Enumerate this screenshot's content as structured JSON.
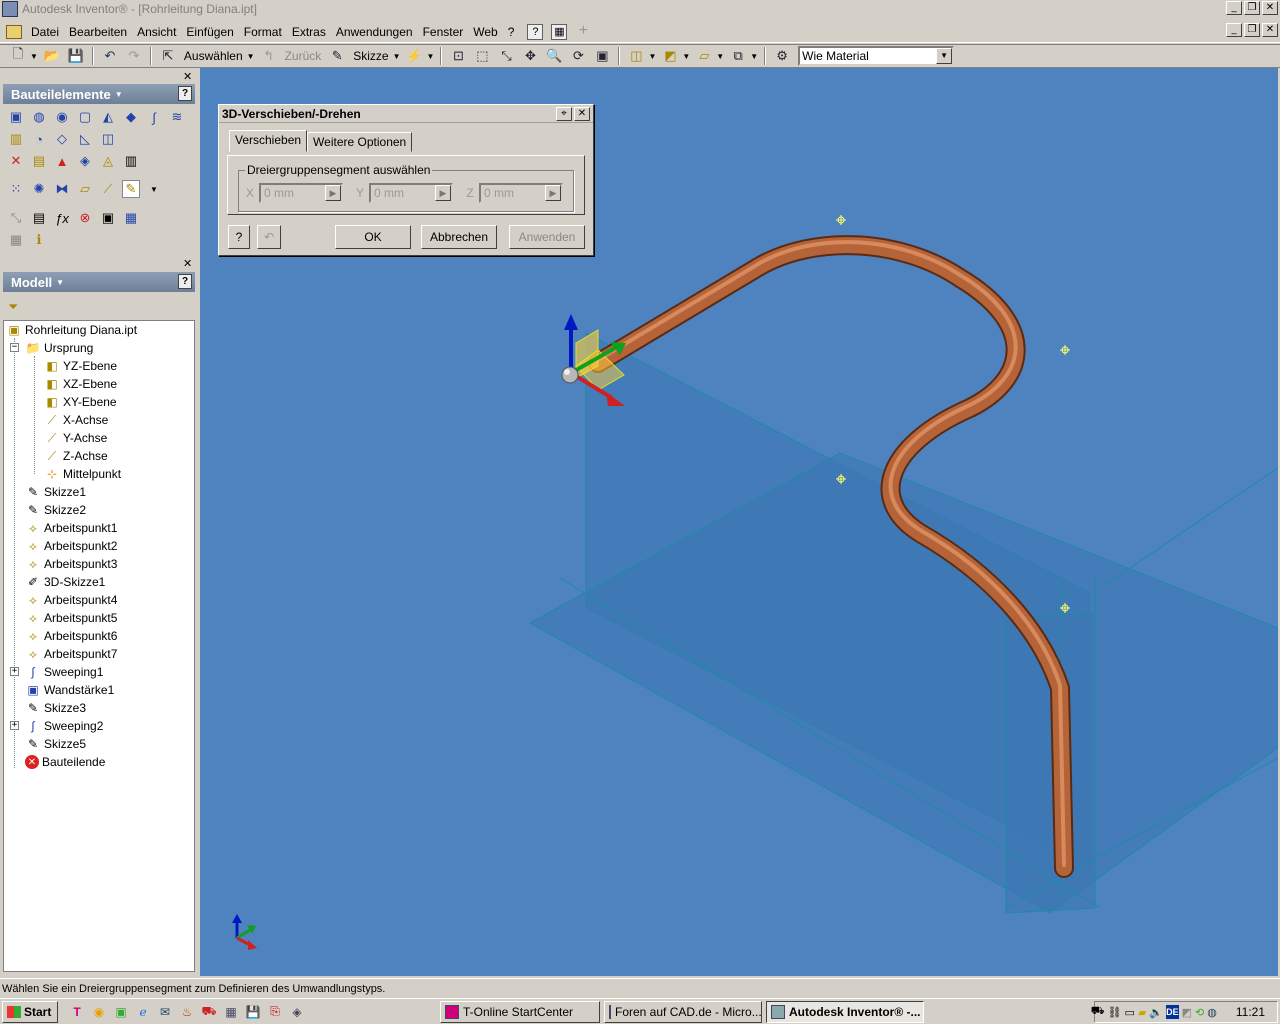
{
  "window": {
    "title": "Autodesk Inventor® - [Rohrleitung Diana.ipt]"
  },
  "menu": [
    "Datei",
    "Bearbeiten",
    "Ansicht",
    "Einfügen",
    "Format",
    "Extras",
    "Anwendungen",
    "Fenster",
    "Web",
    "?"
  ],
  "toolbar": {
    "select_label": "Auswählen",
    "back_label": "Zurück",
    "sketch_label": "Skizze",
    "material_value": "Wie Material"
  },
  "features_panel": {
    "title": "Bauteilelemente"
  },
  "model_panel": {
    "title": "Modell"
  },
  "tree": {
    "root": "Rohrleitung Diana.ipt",
    "origin": "Ursprung",
    "origin_children": [
      "YZ-Ebene",
      "XZ-Ebene",
      "XY-Ebene",
      "X-Achse",
      "Y-Achse",
      "Z-Achse",
      "Mittelpunkt"
    ],
    "items": [
      "Skizze1",
      "Skizze2",
      "Arbeitspunkt1",
      "Arbeitspunkt2",
      "Arbeitspunkt3",
      "3D-Skizze1",
      "Arbeitspunkt4",
      "Arbeitspunkt5",
      "Arbeitspunkt6",
      "Arbeitspunkt7",
      "Sweeping1",
      "Wandstärke1",
      "Skizze3",
      "Sweeping2",
      "Skizze5",
      "Bauteilende"
    ]
  },
  "dialog": {
    "title": "3D-Verschieben/-Drehen",
    "tabs": [
      "Verschieben",
      "Weitere Optionen"
    ],
    "group_label": "Dreiergruppensegment auswählen",
    "x_label": "X",
    "y_label": "Y",
    "z_label": "Z",
    "x_value": "0 mm",
    "y_value": "0 mm",
    "z_value": "0 mm",
    "ok": "OK",
    "cancel": "Abbrechen",
    "apply": "Anwenden"
  },
  "status": {
    "text": "Wählen Sie ein Dreiergruppensegment zum Definieren des Umwandlungstyps."
  },
  "taskbar": {
    "start": "Start",
    "tasks": [
      "T-Online StartCenter",
      "Foren auf CAD.de - Micro...",
      "Autodesk Inventor® -..."
    ],
    "clock": "11:21",
    "lang": "DE"
  },
  "colors": {
    "viewport": "#4e83c0",
    "pipe": "#b5643a",
    "panel_header": "#7f91aa"
  }
}
